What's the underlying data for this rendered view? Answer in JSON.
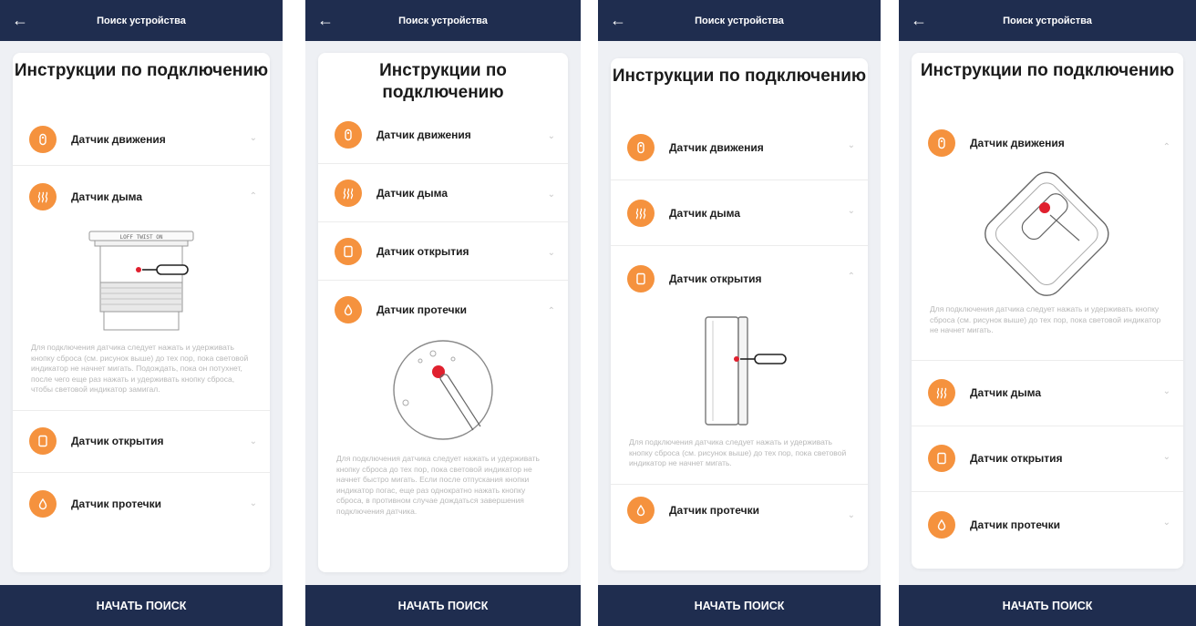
{
  "app": {
    "title": "Поиск устройства",
    "heading": "Инструкции по подключению",
    "search_button": "НАЧАТЬ ПОИСК"
  },
  "sensors": {
    "motion": "Датчик движения",
    "smoke": "Датчик дыма",
    "open": "Датчик открытия",
    "leak": "Датчик протечки"
  },
  "illustration": {
    "smoke_label": "LOFF TWIST ON"
  },
  "instructions": {
    "smoke": "Для подключения датчика следует нажать и удерживать кнопку сброса (см. рисунок выше) до тех пор, пока световой индикатор не начнет мигать. Подождать, пока он потухнет, после чего еще раз нажать и удерживать кнопку сброса, чтобы световой индикатор замигал.",
    "leak": "Для подключения датчика следует нажать и удерживать кнопку сброса до тех пор, пока световой индикатор не начнет быстро мигать. Если после отпускания кнопки индикатор погас, еще раз однократно нажать кнопку сброса, в противном случае дождаться завершения подключения датчика.",
    "open": "Для подключения датчика следует нажать и удерживать кнопку сброса (см. рисунок выше) до тех пор, пока световой индикатор не начнет мигать.",
    "motion": "Для подключения датчика следует нажать и удерживать кнопку сброса (см. рисунок выше) до тех пор, пока световой индикатор не начнет мигать."
  },
  "icons": {
    "back": "back-arrow-icon",
    "chevron": "chevron-down-icon"
  },
  "colors": {
    "navy": "#1f2d4f",
    "orange": "#f5923e",
    "accent_red": "#e0202e"
  }
}
